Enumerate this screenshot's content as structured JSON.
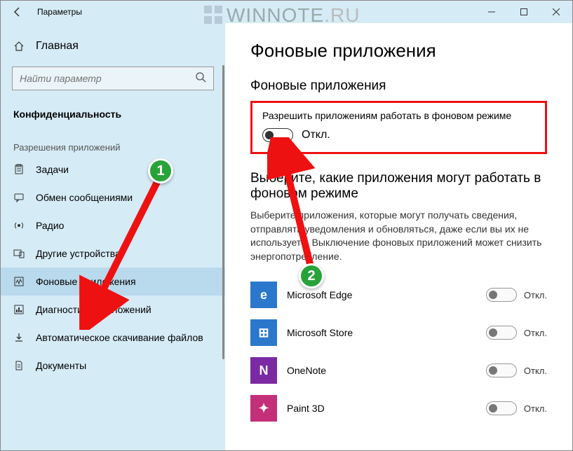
{
  "window": {
    "title": "Параметры"
  },
  "watermark": {
    "text_main": "WINNOTE",
    "text_suffix": ".RU"
  },
  "sidebar": {
    "home_label": "Главная",
    "search_placeholder": "Найти параметр",
    "section": "Конфиденциальность",
    "category": "Разрешения приложений",
    "items": [
      {
        "label": "Задачи"
      },
      {
        "label": "Обмен сообщениями"
      },
      {
        "label": "Радио"
      },
      {
        "label": "Другие устройства"
      },
      {
        "label": "Фоновые приложения"
      },
      {
        "label": "Диагностика приложений"
      },
      {
        "label": "Автоматическое скачивание файлов"
      },
      {
        "label": "Документы"
      }
    ]
  },
  "main": {
    "page_title": "Фоновые приложения",
    "section1_title": "Фоновые приложения",
    "master_toggle_label": "Разрешить приложениям работать в фоновом режиме",
    "master_toggle_state": "Откл.",
    "section2_title": "Выберите, какие приложения могут работать в фоновом режиме",
    "section2_desc": "Выберите приложения, которые могут получать сведения, отправлять уведомления и обновляться, даже если вы их не используете. Выключение фоновых приложений может снизить энергопотребление.",
    "apps": [
      {
        "name": "Microsoft Edge",
        "state": "Откл.",
        "icon_bg": "#2b77cc",
        "icon_letter": "e"
      },
      {
        "name": "Microsoft Store",
        "state": "Откл.",
        "icon_bg": "#2b77cc",
        "icon_letter": "⊞"
      },
      {
        "name": "OneNote",
        "state": "Откл.",
        "icon_bg": "#7b2aa3",
        "icon_letter": "N"
      },
      {
        "name": "Paint 3D",
        "state": "Откл.",
        "icon_bg": "#c42f7a",
        "icon_letter": "✦"
      }
    ]
  },
  "annotations": {
    "badge1": "1",
    "badge2": "2"
  }
}
